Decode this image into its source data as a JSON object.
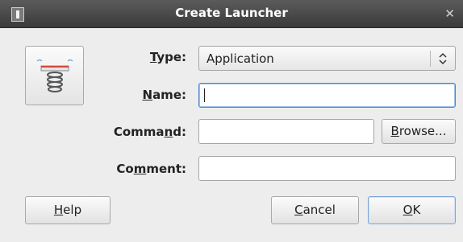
{
  "window": {
    "title": "Create Launcher"
  },
  "form": {
    "type_label_prefix": "",
    "type_label_accel": "T",
    "type_label_rest": "ype:",
    "type_value": "Application",
    "name_label_accel": "N",
    "name_label_rest": "ame:",
    "name_value": "",
    "command_label_pre": "Comma",
    "command_label_accel": "n",
    "command_label_rest": "d:",
    "command_value": "",
    "comment_label_pre": "Co",
    "comment_label_accel": "m",
    "comment_label_rest": "ment:",
    "comment_value": ""
  },
  "buttons": {
    "browse_accel": "B",
    "browse_rest": "rowse...",
    "help_accel": "H",
    "help_rest": "elp",
    "cancel_accel": "C",
    "cancel_rest": "ancel",
    "ok_accel": "O",
    "ok_rest": "K"
  },
  "icons": {
    "window_menu": "window-menu-icon",
    "close": "close-icon",
    "launcher": "launcher-spring-icon",
    "combo_arrow": "updown-arrow-icon"
  },
  "colors": {
    "titlebar": "#3a3a3a",
    "focus": "#4b88cc"
  }
}
